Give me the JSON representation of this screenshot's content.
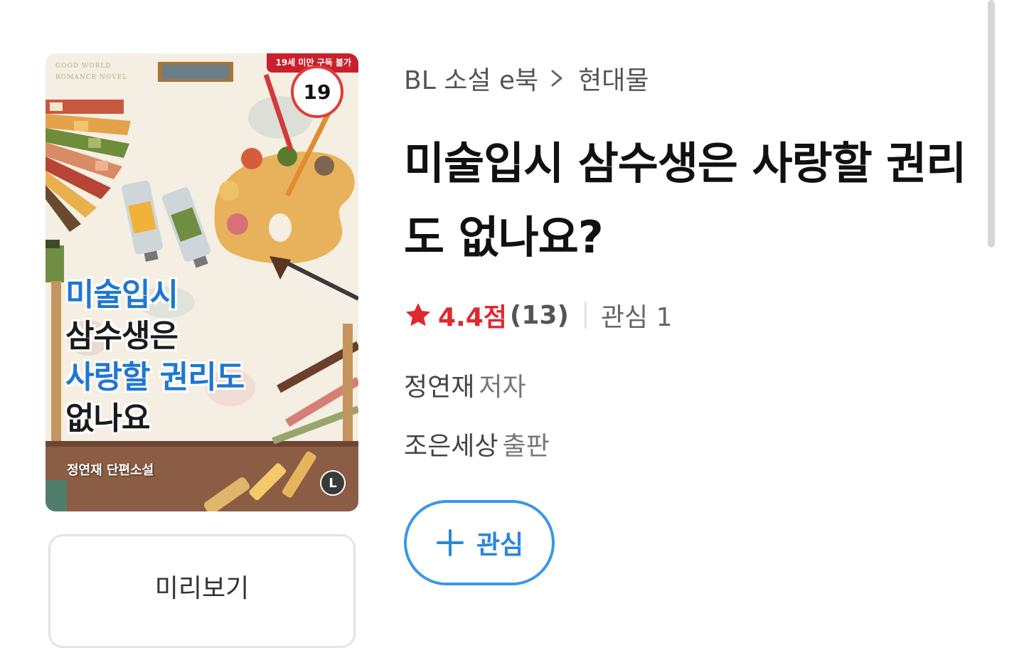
{
  "cover": {
    "brand_line1": "GOOD WORLD",
    "brand_line2": "ROMANCE NOVEL",
    "age_notice": "19세 미만 구독 불가",
    "age_badge": "19",
    "title_lines": [
      "미술입시",
      "삼수생은",
      "사랑할 권리도",
      "없나요"
    ],
    "author_line": "정연재 단편소설",
    "publisher_logo": "L"
  },
  "preview_button": "미리보기",
  "breadcrumb": {
    "category": "BL 소설 e북",
    "subcategory": "현대물",
    "separator_icon": "chevron-right-icon"
  },
  "title": "미술입시 삼수생은 사랑할 권리도 없나요?",
  "rating": {
    "icon": "star-icon",
    "score": "4.4점",
    "count": "(13)",
    "wishlist": "관심 1"
  },
  "author": {
    "name": "정연재",
    "role": "저자"
  },
  "publisher": {
    "name": "조은세상",
    "role": "출판"
  },
  "wish_button": {
    "label": "관심",
    "icon": "plus-icon"
  },
  "colors": {
    "accent_blue": "#2a86dc",
    "rating_red": "#e0282e",
    "age_red": "#c8202c"
  }
}
